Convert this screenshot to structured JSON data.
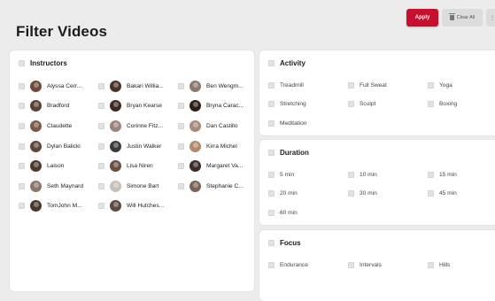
{
  "header": {
    "title": "Filter Videos",
    "apply_label": "Apply",
    "clear_label": "Clear All"
  },
  "instructors": {
    "heading": "Instructors",
    "items": [
      {
        "name": "Alyssa Cerr...",
        "color": "#6e4a3a"
      },
      {
        "name": "Bakari Willia...",
        "color": "#4a3328"
      },
      {
        "name": "Ben Wengm...",
        "color": "#8a7a6e"
      },
      {
        "name": "Bradford",
        "color": "#5a4236"
      },
      {
        "name": "Bryan Kearse",
        "color": "#3d2a22"
      },
      {
        "name": "Bryna Carac...",
        "color": "#2c1e18"
      },
      {
        "name": "Claudette",
        "color": "#7a5a48"
      },
      {
        "name": "Corinne Fitz...",
        "color": "#9a8478"
      },
      {
        "name": "Dan Castillo",
        "color": "#a88a7a"
      },
      {
        "name": "Dylan Balicki",
        "color": "#5e463a"
      },
      {
        "name": "Justin Walker",
        "color": "#3a3a3a"
      },
      {
        "name": "Kirra Michel",
        "color": "#b28a6e"
      },
      {
        "name": "Laison",
        "color": "#4e3a30"
      },
      {
        "name": "Lisa Niren",
        "color": "#6a4e3e"
      },
      {
        "name": "Margaret Va...",
        "color": "#3a2c26"
      },
      {
        "name": "Seth Maynard",
        "color": "#8a766a"
      },
      {
        "name": "Simone Bart",
        "color": "#c8c0b8"
      },
      {
        "name": "Stephanie C...",
        "color": "#7a6458"
      },
      {
        "name": "TomJohn M...",
        "color": "#4a382e"
      },
      {
        "name": "Will Hutches...",
        "color": "#5a4a40"
      }
    ]
  },
  "activity": {
    "heading": "Activity",
    "options": [
      "Treadmill",
      "Full Sweat",
      "Yoga",
      "Stretching",
      "Sculpt",
      "Boxing",
      "Meditation"
    ]
  },
  "duration": {
    "heading": "Duration",
    "options": [
      "5 min",
      "10 min",
      "15 min",
      "20 min",
      "30 min",
      "45 min",
      "60 min"
    ]
  },
  "focus": {
    "heading": "Focus",
    "options": [
      "Endurance",
      "Intervals",
      "Hills"
    ]
  },
  "colors": {
    "accent": "#c8102e",
    "background": "#ececec"
  }
}
